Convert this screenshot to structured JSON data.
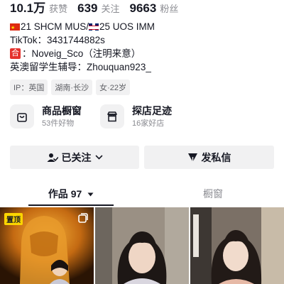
{
  "stats": [
    {
      "value": "10.1万",
      "label": "获赞"
    },
    {
      "value": "639",
      "label": "关注"
    },
    {
      "value": "9663",
      "label": "粉丝"
    }
  ],
  "bio": {
    "line1_cn": "21 SHCM MUS/",
    "line1_uk": "25 UOS IMM",
    "line2": "TikTok：3431744882s",
    "line3_badge": "合",
    "line3": "：Noveig_Sco（注明来意）",
    "line4": "英澳留学生辅导：Zhouquan923_"
  },
  "tags": [
    "IP：英国",
    "湖南·长沙",
    "女·22岁"
  ],
  "shop": {
    "window_title": "商品橱窗",
    "window_sub": "53件好物",
    "visit_title": "探店足迹",
    "visit_sub": "16家好店"
  },
  "actions": {
    "followed_label": "已关注",
    "message_label": "发私信"
  },
  "tabs": {
    "works_label": "作品 97",
    "showcase_label": "橱窗"
  },
  "grid": {
    "pin_label": "置顶"
  },
  "colors": {
    "accent_dark": "#161823",
    "muted": "#8a8b91",
    "chip_bg": "#f1f1f2",
    "pin_yellow": "#fcd500"
  }
}
